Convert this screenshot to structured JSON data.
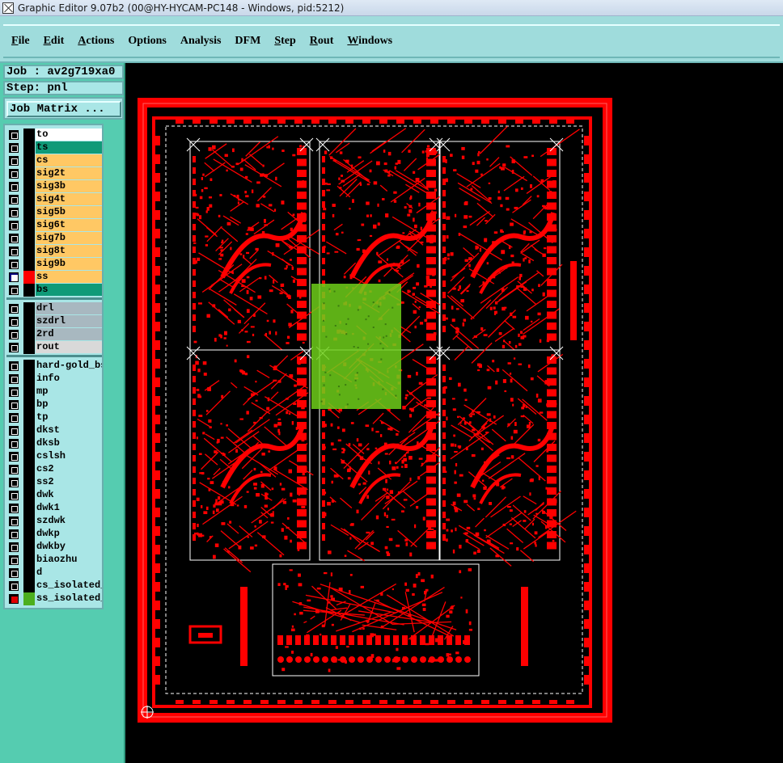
{
  "window": {
    "title": "Graphic Editor 9.07b2 (00@HY-HYCAM-PC148 - Windows, pid:5212)"
  },
  "menu": [
    {
      "label": "File",
      "key": "F",
      "rest": "ile"
    },
    {
      "label": "Edit",
      "key": "E",
      "rest": "dit"
    },
    {
      "label": "Actions",
      "key": "A",
      "rest": "ctions"
    },
    {
      "label": "Options",
      "key": "",
      "rest": "Options"
    },
    {
      "label": "Analysis",
      "key": "",
      "rest": "Analysis"
    },
    {
      "label": "DFM",
      "key": "",
      "rest": "DFM"
    },
    {
      "label": "Step",
      "key": "S",
      "rest": "tep"
    },
    {
      "label": "Rout",
      "key": "R",
      "rest": "out"
    },
    {
      "label": "Windows",
      "key": "W",
      "rest": "indows"
    }
  ],
  "job": {
    "label": "Job : av2g719xa0",
    "step_label": "Step: pnl"
  },
  "job_matrix_label": "Job Matrix ...",
  "layer_groups": [
    [
      {
        "name": "to",
        "bg": "#ffffff",
        "swatch": "#000000",
        "check": ""
      },
      {
        "name": "ts",
        "bg": "#0f9a78",
        "swatch": "#000000",
        "check": ""
      },
      {
        "name": "cs",
        "bg": "#ffc864",
        "swatch": "#000000",
        "check": ""
      },
      {
        "name": "sig2t",
        "bg": "#ffc864",
        "swatch": "#000000",
        "check": ""
      },
      {
        "name": "sig3b",
        "bg": "#ffc864",
        "swatch": "#000000",
        "check": ""
      },
      {
        "name": "sig4t",
        "bg": "#ffc864",
        "swatch": "#000000",
        "check": ""
      },
      {
        "name": "sig5b",
        "bg": "#ffc864",
        "swatch": "#000000",
        "check": ""
      },
      {
        "name": "sig6t",
        "bg": "#ffc864",
        "swatch": "#000000",
        "check": ""
      },
      {
        "name": "sig7b",
        "bg": "#ffc864",
        "swatch": "#000000",
        "check": ""
      },
      {
        "name": "sig8t",
        "bg": "#ffc864",
        "swatch": "#000000",
        "check": ""
      },
      {
        "name": "sig9b",
        "bg": "#ffc864",
        "swatch": "#000000",
        "check": ""
      },
      {
        "name": "ss",
        "bg": "#ffc864",
        "swatch": "#ff0000",
        "check": "sel"
      },
      {
        "name": "bs",
        "bg": "#0f9a78",
        "swatch": "#000000",
        "check": ""
      }
    ],
    [
      {
        "name": "drl",
        "bg": "#a8b8c0",
        "swatch": "#000000",
        "check": ""
      },
      {
        "name": "szdrl",
        "bg": "#a8b8c0",
        "swatch": "#000000",
        "check": ""
      },
      {
        "name": "2rd",
        "bg": "#a8b8c0",
        "swatch": "#000000",
        "check": ""
      },
      {
        "name": "rout",
        "bg": "#d9d9d9",
        "swatch": "#000000",
        "check": ""
      }
    ],
    [
      {
        "name": "hard-gold_bs",
        "bg": "#a9e6e6",
        "swatch": "#000000",
        "check": ""
      },
      {
        "name": "info",
        "bg": "#a9e6e6",
        "swatch": "#000000",
        "check": ""
      },
      {
        "name": "mp",
        "bg": "#a9e6e6",
        "swatch": "#000000",
        "check": ""
      },
      {
        "name": "bp",
        "bg": "#a9e6e6",
        "swatch": "#000000",
        "check": ""
      },
      {
        "name": "tp",
        "bg": "#a9e6e6",
        "swatch": "#000000",
        "check": ""
      },
      {
        "name": "dkst",
        "bg": "#a9e6e6",
        "swatch": "#000000",
        "check": ""
      },
      {
        "name": "dksb",
        "bg": "#a9e6e6",
        "swatch": "#000000",
        "check": ""
      },
      {
        "name": "cslsh",
        "bg": "#a9e6e6",
        "swatch": "#000000",
        "check": ""
      },
      {
        "name": "cs2",
        "bg": "#a9e6e6",
        "swatch": "#000000",
        "check": ""
      },
      {
        "name": "ss2",
        "bg": "#a9e6e6",
        "swatch": "#000000",
        "check": ""
      },
      {
        "name": "dwk",
        "bg": "#a9e6e6",
        "swatch": "#000000",
        "check": ""
      },
      {
        "name": "dwk1",
        "bg": "#a9e6e6",
        "swatch": "#000000",
        "check": ""
      },
      {
        "name": "szdwk",
        "bg": "#a9e6e6",
        "swatch": "#000000",
        "check": ""
      },
      {
        "name": "dwkp",
        "bg": "#a9e6e6",
        "swatch": "#000000",
        "check": ""
      },
      {
        "name": "dwkby",
        "bg": "#a9e6e6",
        "swatch": "#000000",
        "check": ""
      },
      {
        "name": "biaozhu",
        "bg": "#a9e6e6",
        "swatch": "#000000",
        "check": ""
      },
      {
        "name": "d",
        "bg": "#a9e6e6",
        "swatch": "#000000",
        "check": ""
      },
      {
        "name": "cs_isolated_",
        "bg": "#a9e6e6",
        "swatch": "#000000",
        "check": ""
      },
      {
        "name": "ss_isolated_",
        "bg": "#a9e6e6",
        "swatch": "#4caf1e",
        "check": "red"
      }
    ]
  ],
  "colors": {
    "copper_red": "#ff0000",
    "highlight_green": "#6fcf1a",
    "outline_white": "#ffffff"
  }
}
